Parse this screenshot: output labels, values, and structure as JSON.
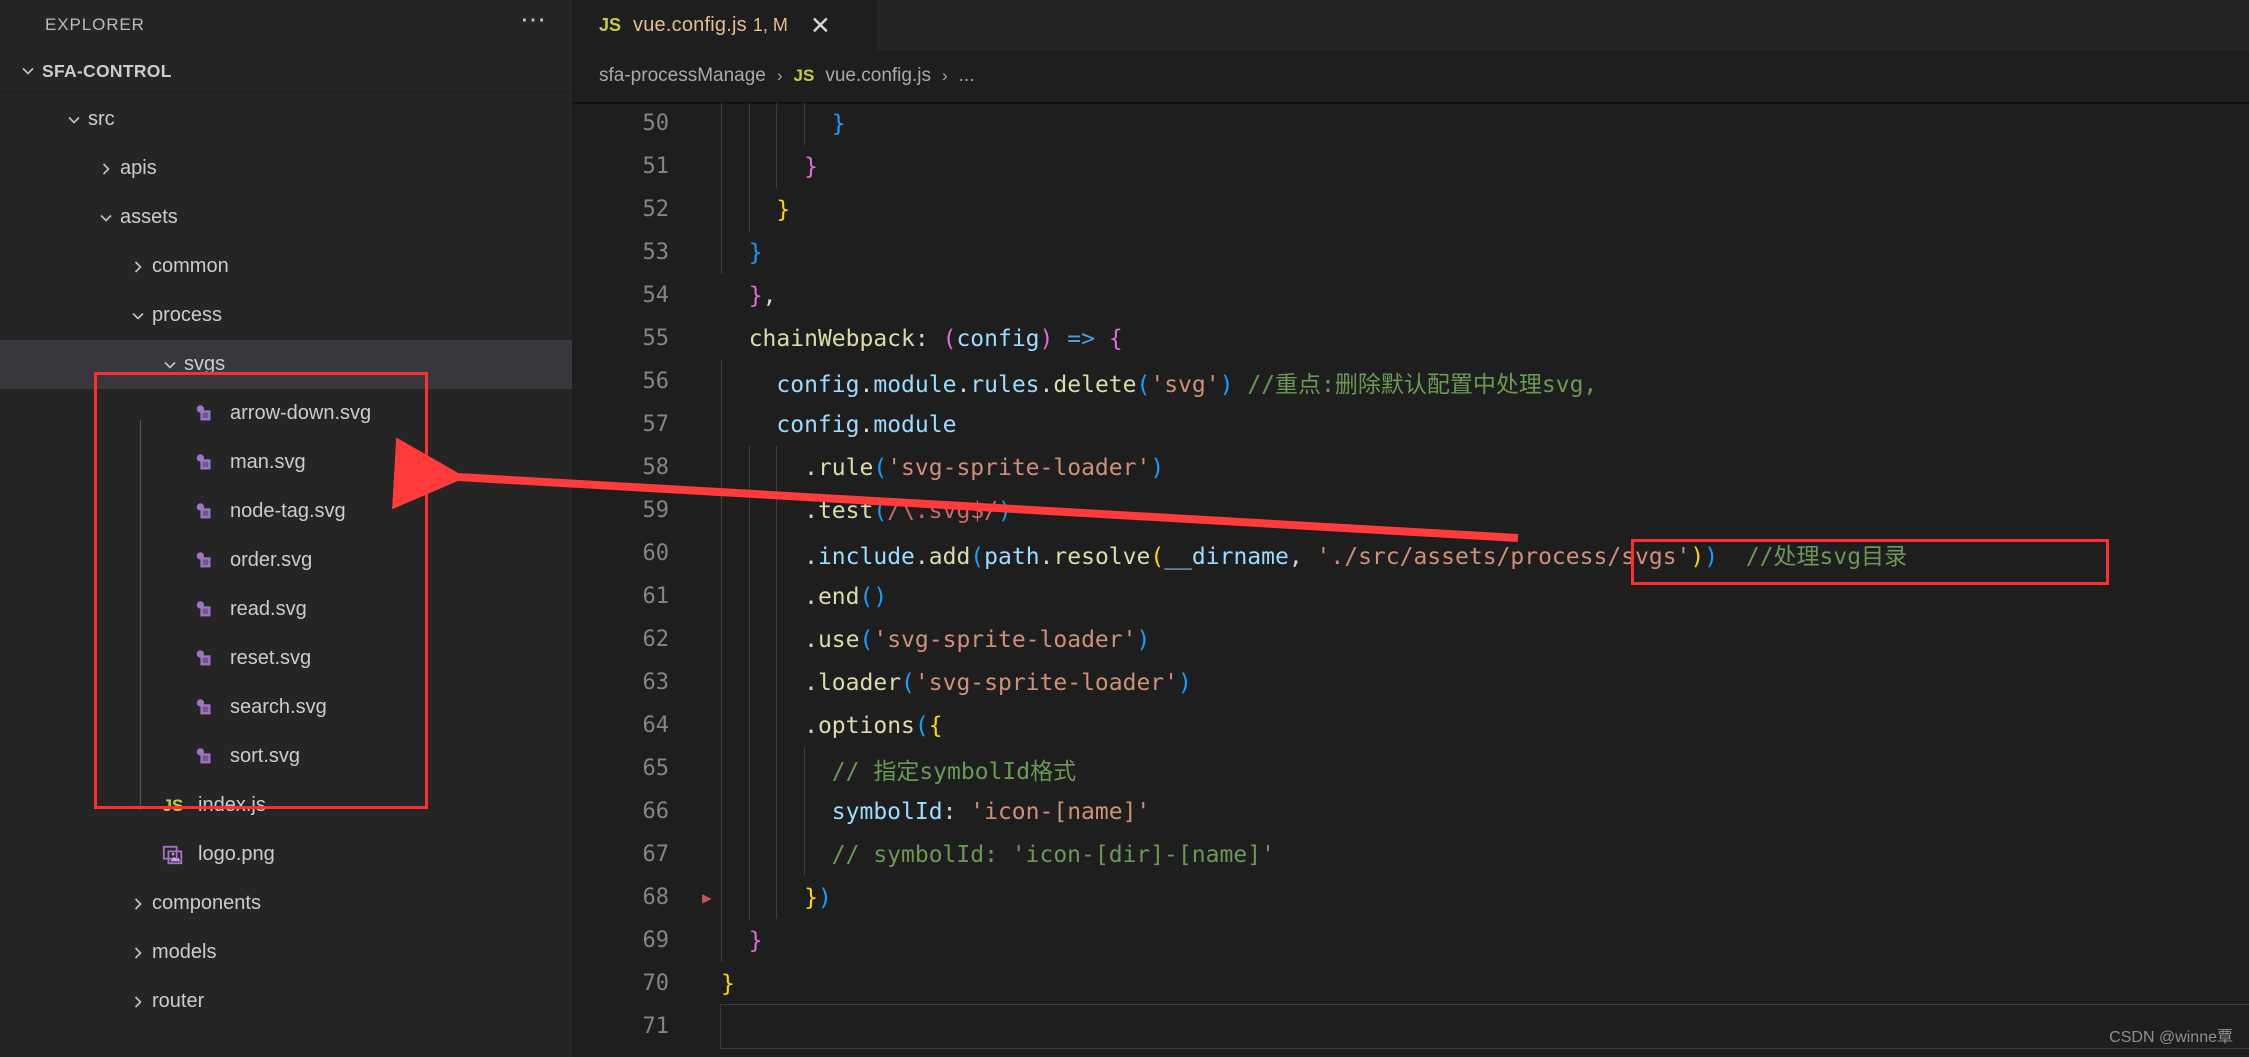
{
  "sidebar": {
    "title": "EXPLORER",
    "more_icon": "ellipsis-icon",
    "root": {
      "label": "SFA-CONTROL",
      "expanded": true
    },
    "items": [
      {
        "label": "src",
        "type": "folder",
        "state": "expanded",
        "depth": 1,
        "selected": false
      },
      {
        "label": "apis",
        "type": "folder",
        "state": "collapsed",
        "depth": 2,
        "selected": false
      },
      {
        "label": "assets",
        "type": "folder",
        "state": "expanded",
        "depth": 2,
        "selected": false
      },
      {
        "label": "common",
        "type": "folder",
        "state": "collapsed",
        "depth": 3,
        "selected": false
      },
      {
        "label": "process",
        "type": "folder",
        "state": "expanded",
        "depth": 3,
        "selected": false
      },
      {
        "label": "svgs",
        "type": "folder",
        "state": "expanded",
        "depth": 4,
        "selected": true
      },
      {
        "label": "arrow-down.svg",
        "type": "svg",
        "state": "file",
        "depth": 5,
        "selected": false
      },
      {
        "label": "man.svg",
        "type": "svg",
        "state": "file",
        "depth": 5,
        "selected": false
      },
      {
        "label": "node-tag.svg",
        "type": "svg",
        "state": "file",
        "depth": 5,
        "selected": false
      },
      {
        "label": "order.svg",
        "type": "svg",
        "state": "file",
        "depth": 5,
        "selected": false
      },
      {
        "label": "read.svg",
        "type": "svg",
        "state": "file",
        "depth": 5,
        "selected": false
      },
      {
        "label": "reset.svg",
        "type": "svg",
        "state": "file",
        "depth": 5,
        "selected": false
      },
      {
        "label": "search.svg",
        "type": "svg",
        "state": "file",
        "depth": 5,
        "selected": false
      },
      {
        "label": "sort.svg",
        "type": "svg",
        "state": "file",
        "depth": 5,
        "selected": false
      },
      {
        "label": "index.js",
        "type": "js",
        "state": "file",
        "depth": 4,
        "selected": false
      },
      {
        "label": "logo.png",
        "type": "image",
        "state": "file",
        "depth": 4,
        "selected": false
      },
      {
        "label": "components",
        "type": "folder",
        "state": "collapsed",
        "depth": 3,
        "selected": false
      },
      {
        "label": "models",
        "type": "folder",
        "state": "collapsed",
        "depth": 3,
        "selected": false
      },
      {
        "label": "router",
        "type": "folder",
        "state": "collapsed",
        "depth": 3,
        "selected": false
      }
    ]
  },
  "editor": {
    "tab": {
      "icon": "js-file-icon",
      "label": "vue.config.js",
      "state_badge": "1, M",
      "close_icon": "close-icon"
    },
    "breadcrumb": [
      {
        "label": "sfa-processManage",
        "icon": null
      },
      {
        "label": "vue.config.js",
        "icon": "js-file-icon"
      },
      {
        "label": "...",
        "icon": null
      }
    ],
    "breadcrumb_separator": "›"
  },
  "code": {
    "first_line": 50,
    "lines": [
      {
        "n": 50,
        "indent_guides": [
          0,
          1,
          2,
          3
        ],
        "tokens": [
          {
            "t": "        ",
            "c": "t-plain"
          },
          {
            "t": "}",
            "c": "b3"
          }
        ]
      },
      {
        "n": 51,
        "indent_guides": [
          0,
          1,
          2
        ],
        "tokens": [
          {
            "t": "      ",
            "c": "t-plain"
          },
          {
            "t": "}",
            "c": "b2"
          }
        ]
      },
      {
        "n": 52,
        "indent_guides": [
          0,
          1
        ],
        "tokens": [
          {
            "t": "    ",
            "c": "t-plain"
          },
          {
            "t": "}",
            "c": "b1"
          }
        ]
      },
      {
        "n": 53,
        "indent_guides": [
          0
        ],
        "tokens": [
          {
            "t": "  ",
            "c": "t-plain"
          },
          {
            "t": "}",
            "c": "b3"
          }
        ]
      },
      {
        "n": 54,
        "indent_guides": [],
        "tokens": [
          {
            "t": "  ",
            "c": "t-plain"
          },
          {
            "t": "}",
            "c": "b2"
          },
          {
            "t": ",",
            "c": "t-plain"
          }
        ]
      },
      {
        "n": 55,
        "indent_guides": [],
        "tokens": [
          {
            "t": "  ",
            "c": "t-plain"
          },
          {
            "t": "chainWebpack",
            "c": "t-prop"
          },
          {
            "t": ": ",
            "c": "t-plain"
          },
          {
            "t": "(",
            "c": "b2"
          },
          {
            "t": "config",
            "c": "t-var"
          },
          {
            "t": ")",
            "c": "b2"
          },
          {
            "t": " ",
            "c": "t-plain"
          },
          {
            "t": "=>",
            "c": "t-key"
          },
          {
            "t": " ",
            "c": "t-plain"
          },
          {
            "t": "{",
            "c": "b2"
          }
        ]
      },
      {
        "n": 56,
        "indent_guides": [
          0
        ],
        "tokens": [
          {
            "t": "    ",
            "c": "t-plain"
          },
          {
            "t": "config",
            "c": "t-var"
          },
          {
            "t": ".",
            "c": "t-plain"
          },
          {
            "t": "module",
            "c": "t-var"
          },
          {
            "t": ".",
            "c": "t-plain"
          },
          {
            "t": "rules",
            "c": "t-var"
          },
          {
            "t": ".",
            "c": "t-plain"
          },
          {
            "t": "delete",
            "c": "t-prop"
          },
          {
            "t": "(",
            "c": "b3"
          },
          {
            "t": "'svg'",
            "c": "t-str"
          },
          {
            "t": ")",
            "c": "b3"
          },
          {
            "t": " ",
            "c": "t-plain"
          },
          {
            "t": "//重点:删除默认配置中处理svg,",
            "c": "t-comment"
          }
        ]
      },
      {
        "n": 57,
        "indent_guides": [
          0
        ],
        "tokens": [
          {
            "t": "    ",
            "c": "t-plain"
          },
          {
            "t": "config",
            "c": "t-var"
          },
          {
            "t": ".",
            "c": "t-plain"
          },
          {
            "t": "module",
            "c": "t-var"
          }
        ]
      },
      {
        "n": 58,
        "indent_guides": [
          0,
          1,
          2
        ],
        "tokens": [
          {
            "t": "      ",
            "c": "t-plain"
          },
          {
            "t": ".",
            "c": "t-plain"
          },
          {
            "t": "rule",
            "c": "t-prop"
          },
          {
            "t": "(",
            "c": "b3"
          },
          {
            "t": "'svg-sprite-loader'",
            "c": "t-str"
          },
          {
            "t": ")",
            "c": "b3"
          }
        ]
      },
      {
        "n": 59,
        "indent_guides": [
          0,
          1,
          2
        ],
        "tokens": [
          {
            "t": "      ",
            "c": "t-plain"
          },
          {
            "t": ".",
            "c": "t-plain"
          },
          {
            "t": "test",
            "c": "t-prop"
          },
          {
            "t": "(",
            "c": "b3"
          },
          {
            "t": "/\\.svg$/",
            "c": "t-regex"
          },
          {
            "t": ")",
            "c": "b3"
          }
        ]
      },
      {
        "n": 60,
        "indent_guides": [
          0,
          1,
          2
        ],
        "tokens": [
          {
            "t": "      ",
            "c": "t-plain"
          },
          {
            "t": ".",
            "c": "t-plain"
          },
          {
            "t": "include",
            "c": "t-var"
          },
          {
            "t": ".",
            "c": "t-plain"
          },
          {
            "t": "add",
            "c": "t-prop"
          },
          {
            "t": "(",
            "c": "b3"
          },
          {
            "t": "path",
            "c": "t-var"
          },
          {
            "t": ".",
            "c": "t-plain"
          },
          {
            "t": "resolve",
            "c": "t-prop"
          },
          {
            "t": "(",
            "c": "b1"
          },
          {
            "t": "__dirname",
            "c": "t-var"
          },
          {
            "t": ", ",
            "c": "t-plain"
          },
          {
            "t": "'./src/assets/process/svgs'",
            "c": "t-str"
          },
          {
            "t": ")",
            "c": "b1"
          },
          {
            "t": ")",
            "c": "b3"
          },
          {
            "t": "  ",
            "c": "t-plain"
          },
          {
            "t": "//处理svg目录",
            "c": "t-comment"
          }
        ]
      },
      {
        "n": 61,
        "indent_guides": [
          0,
          1,
          2
        ],
        "tokens": [
          {
            "t": "      ",
            "c": "t-plain"
          },
          {
            "t": ".",
            "c": "t-plain"
          },
          {
            "t": "end",
            "c": "t-prop"
          },
          {
            "t": "(",
            "c": "b3"
          },
          {
            "t": ")",
            "c": "b3"
          }
        ]
      },
      {
        "n": 62,
        "indent_guides": [
          0,
          1,
          2
        ],
        "tokens": [
          {
            "t": "      ",
            "c": "t-plain"
          },
          {
            "t": ".",
            "c": "t-plain"
          },
          {
            "t": "use",
            "c": "t-prop"
          },
          {
            "t": "(",
            "c": "b3"
          },
          {
            "t": "'svg-sprite-loader'",
            "c": "t-str"
          },
          {
            "t": ")",
            "c": "b3"
          }
        ]
      },
      {
        "n": 63,
        "indent_guides": [
          0,
          1,
          2
        ],
        "tokens": [
          {
            "t": "      ",
            "c": "t-plain"
          },
          {
            "t": ".",
            "c": "t-plain"
          },
          {
            "t": "loader",
            "c": "t-prop"
          },
          {
            "t": "(",
            "c": "b3"
          },
          {
            "t": "'svg-sprite-loader'",
            "c": "t-str"
          },
          {
            "t": ")",
            "c": "b3"
          }
        ]
      },
      {
        "n": 64,
        "indent_guides": [
          0,
          1,
          2
        ],
        "tokens": [
          {
            "t": "      ",
            "c": "t-plain"
          },
          {
            "t": ".",
            "c": "t-plain"
          },
          {
            "t": "options",
            "c": "t-prop"
          },
          {
            "t": "(",
            "c": "b3"
          },
          {
            "t": "{",
            "c": "b1"
          }
        ]
      },
      {
        "n": 65,
        "indent_guides": [
          0,
          1,
          2,
          3
        ],
        "tokens": [
          {
            "t": "        ",
            "c": "t-plain"
          },
          {
            "t": "// 指定symbolId格式",
            "c": "t-comment"
          }
        ]
      },
      {
        "n": 66,
        "indent_guides": [
          0,
          1,
          2,
          3
        ],
        "tokens": [
          {
            "t": "        ",
            "c": "t-plain"
          },
          {
            "t": "symbolId",
            "c": "t-var"
          },
          {
            "t": ": ",
            "c": "t-plain"
          },
          {
            "t": "'icon-[name]'",
            "c": "t-str"
          }
        ]
      },
      {
        "n": 67,
        "indent_guides": [
          0,
          1,
          2,
          3
        ],
        "tokens": [
          {
            "t": "        ",
            "c": "t-plain"
          },
          {
            "t": "// symbolId: 'icon-[dir]-[name]'",
            "c": "t-comment"
          }
        ]
      },
      {
        "n": 68,
        "indent_guides": [
          0,
          1,
          2
        ],
        "tokens": [
          {
            "t": "      ",
            "c": "t-plain"
          },
          {
            "t": "}",
            "c": "b1"
          },
          {
            "t": ")",
            "c": "b3"
          }
        ],
        "fold_marker": true
      },
      {
        "n": 69,
        "indent_guides": [
          0
        ],
        "tokens": [
          {
            "t": "  ",
            "c": "t-plain"
          },
          {
            "t": "}",
            "c": "b2"
          }
        ]
      },
      {
        "n": 70,
        "indent_guides": [],
        "tokens": [
          {
            "t": "}",
            "c": "b1"
          }
        ]
      },
      {
        "n": 71,
        "indent_guides": [],
        "tokens": [],
        "current": true
      }
    ]
  },
  "annotations": {
    "box_color": "#ff2d2d",
    "arrow_color": "#ff3b3b",
    "sidebar_box_label": "svgs-folder-highlight",
    "code_box_label": "svgs-path-string-highlight",
    "arrow_label": "path-to-folder-arrow"
  },
  "watermark": {
    "text": "CSDN @winne覃"
  }
}
